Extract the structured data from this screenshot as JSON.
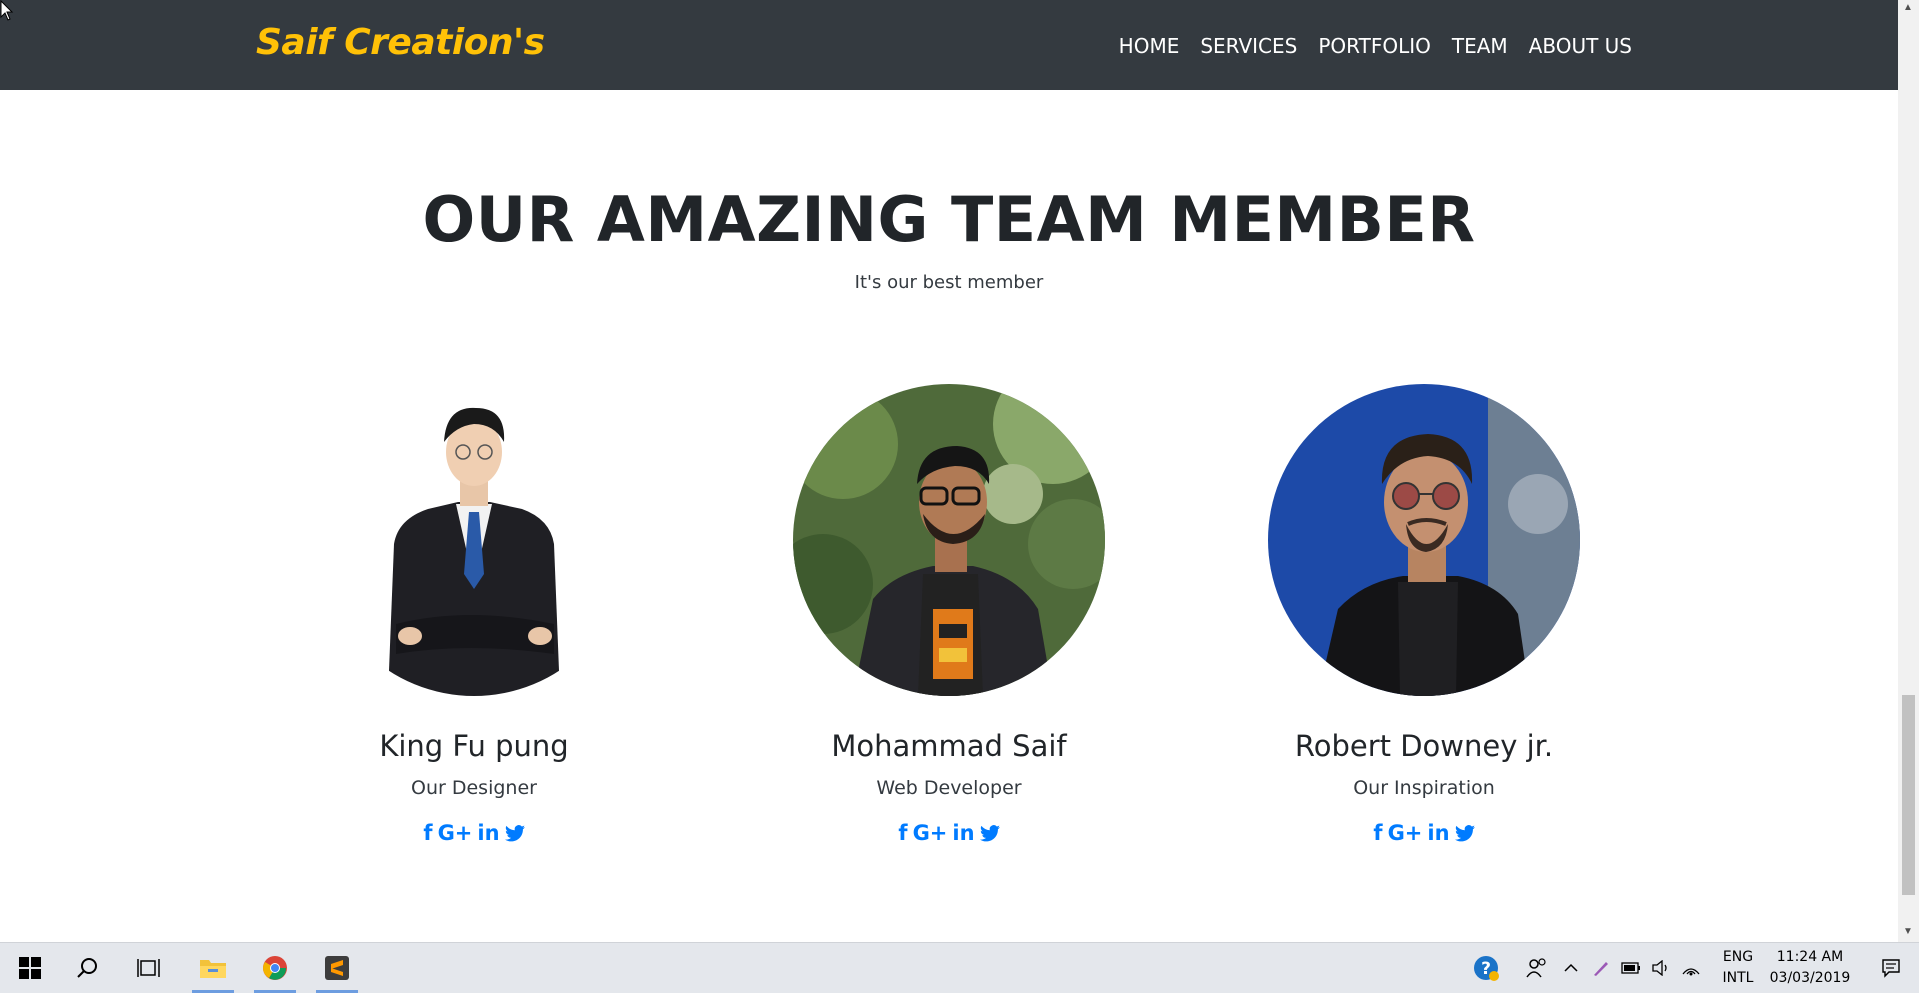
{
  "navbar": {
    "brand": "Saif Creation's",
    "links": [
      "HOME",
      "SERVICES",
      "PORTFOLIO",
      "TEAM",
      "ABOUT US"
    ]
  },
  "section": {
    "title": "OUR AMAZING TEAM MEMBER",
    "subtitle": "It's our best member"
  },
  "team": [
    {
      "name": "King Fu pung",
      "role": "Our Designer"
    },
    {
      "name": "Mohammad Saif",
      "role": "Web Developer"
    },
    {
      "name": "Robert Downey jr.",
      "role": "Our Inspiration"
    }
  ],
  "social_icons": [
    "facebook-icon",
    "google-plus-icon",
    "linkedin-icon",
    "twitter-icon"
  ],
  "social_glyphs": {
    "facebook": "f",
    "google_plus": "G+",
    "linkedin": "in"
  },
  "taskbar": {
    "language": "ENG",
    "layout": "INTL",
    "time": "11:24 AM",
    "date": "03/03/2019"
  },
  "colors": {
    "navbar_bg": "#343a40",
    "brand": "#ffc107",
    "social": "#007bff",
    "heading": "#212529"
  }
}
